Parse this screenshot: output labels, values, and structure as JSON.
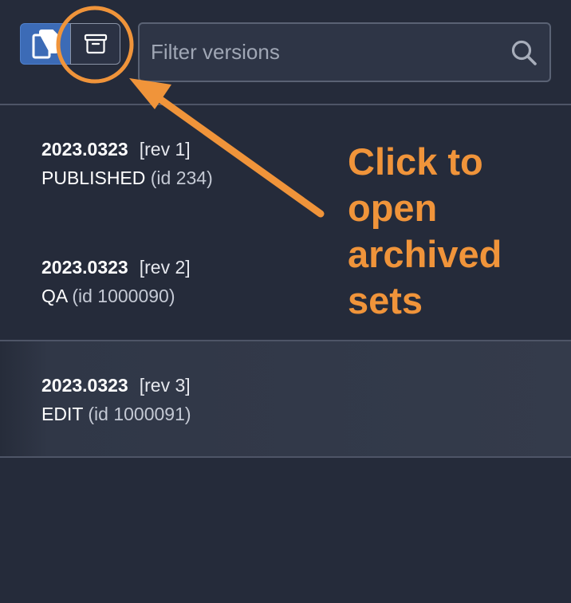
{
  "search": {
    "placeholder": "Filter versions",
    "value": ""
  },
  "toolbar": {
    "copy_icon": "copy-icon",
    "archive_icon": "archive-icon",
    "search_icon": "search-icon"
  },
  "versions": [
    {
      "date": "2023.0323",
      "rev": "[rev 1]",
      "status": "PUBLISHED",
      "id": "(id 234)"
    },
    {
      "date": "2023.0323",
      "rev": "[rev 2]",
      "status": "QA",
      "id": "(id 1000090)"
    },
    {
      "date": "2023.0323",
      "rev": "[rev 3]",
      "status": "EDIT",
      "id": "(id 1000091)"
    }
  ],
  "annotation": {
    "lines": [
      "Click to",
      "open",
      "archived",
      "sets"
    ],
    "color": "#f0943a"
  },
  "colors": {
    "background": "#252b3a",
    "active_button": "#3c6bb6",
    "selected_row": "#343b4b",
    "annotation": "#f0943a"
  }
}
